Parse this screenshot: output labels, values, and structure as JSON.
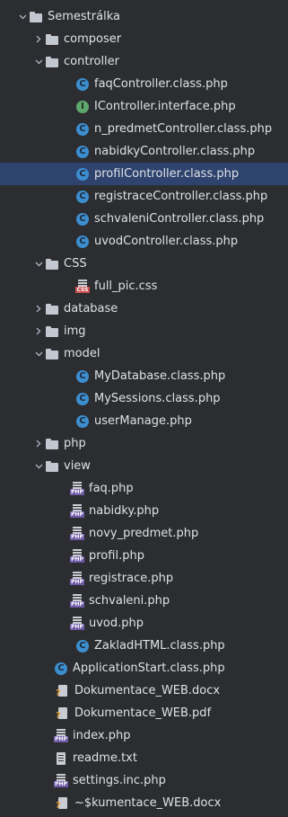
{
  "project_tree": {
    "root": {
      "label": "Semestrálka",
      "icon": "folder-icon",
      "expanded": true
    },
    "composer": {
      "label": "composer",
      "icon": "folder-icon",
      "expanded": false
    },
    "controller": {
      "label": "controller",
      "icon": "folder-icon",
      "expanded": true,
      "files": [
        {
          "label": "faqController.class.php",
          "icon": "php-class-icon"
        },
        {
          "label": "IController.interface.php",
          "icon": "php-interface-icon"
        },
        {
          "label": "n_predmetController.class.php",
          "icon": "php-class-icon"
        },
        {
          "label": "nabidkyController.class.php",
          "icon": "php-class-icon"
        },
        {
          "label": "profilController.class.php",
          "icon": "php-class-icon",
          "selected": true
        },
        {
          "label": "registraceController.class.php",
          "icon": "php-class-icon"
        },
        {
          "label": "schvaleniController.class.php",
          "icon": "php-class-icon"
        },
        {
          "label": "uvodController.class.php",
          "icon": "php-class-icon"
        }
      ]
    },
    "css": {
      "label": "CSS",
      "icon": "folder-icon",
      "expanded": true,
      "files": [
        {
          "label": "full_pic.css",
          "icon": "css-file-icon"
        }
      ]
    },
    "database": {
      "label": "database",
      "icon": "folder-icon",
      "expanded": false
    },
    "img": {
      "label": "img",
      "icon": "folder-icon",
      "expanded": false
    },
    "model": {
      "label": "model",
      "icon": "folder-icon",
      "expanded": true,
      "files": [
        {
          "label": "MyDatabase.class.php",
          "icon": "php-class-icon"
        },
        {
          "label": "MySessions.class.php",
          "icon": "php-class-icon"
        },
        {
          "label": "userManage.php",
          "icon": "php-class-icon"
        }
      ]
    },
    "php": {
      "label": "php",
      "icon": "folder-icon",
      "expanded": false
    },
    "view": {
      "label": "view",
      "icon": "folder-icon",
      "expanded": true,
      "files": [
        {
          "label": "faq.php",
          "icon": "php-file-icon"
        },
        {
          "label": "nabidky.php",
          "icon": "php-file-icon"
        },
        {
          "label": "novy_predmet.php",
          "icon": "php-file-icon"
        },
        {
          "label": "profil.php",
          "icon": "php-file-icon"
        },
        {
          "label": "registrace.php",
          "icon": "php-file-icon"
        },
        {
          "label": "schvaleni.php",
          "icon": "php-file-icon"
        },
        {
          "label": "uvod.php",
          "icon": "php-file-icon"
        },
        {
          "label": "ZakladHTML.class.php",
          "icon": "php-class-icon"
        }
      ]
    },
    "root_files": [
      {
        "label": "ApplicationStart.class.php",
        "icon": "php-class-icon"
      },
      {
        "label": "Dokumentace_WEB.docx",
        "icon": "unknown-file-icon"
      },
      {
        "label": "Dokumentace_WEB.pdf",
        "icon": "unknown-file-icon"
      },
      {
        "label": "index.php",
        "icon": "php-file-icon"
      },
      {
        "label": "readme.txt",
        "icon": "text-file-icon"
      },
      {
        "label": "settings.inc.php",
        "icon": "php-file-icon"
      },
      {
        "label": "~$kumentace_WEB.docx",
        "icon": "unknown-file-icon"
      }
    ]
  },
  "colors": {
    "background": "#2b2d30",
    "selection": "#2e436e",
    "text": "#dfe1e5",
    "class_icon": "#3d8ecf",
    "interface_icon": "#5fa86d",
    "php_badge": "#6f5aa8",
    "css_badge": "#c94f4f"
  }
}
